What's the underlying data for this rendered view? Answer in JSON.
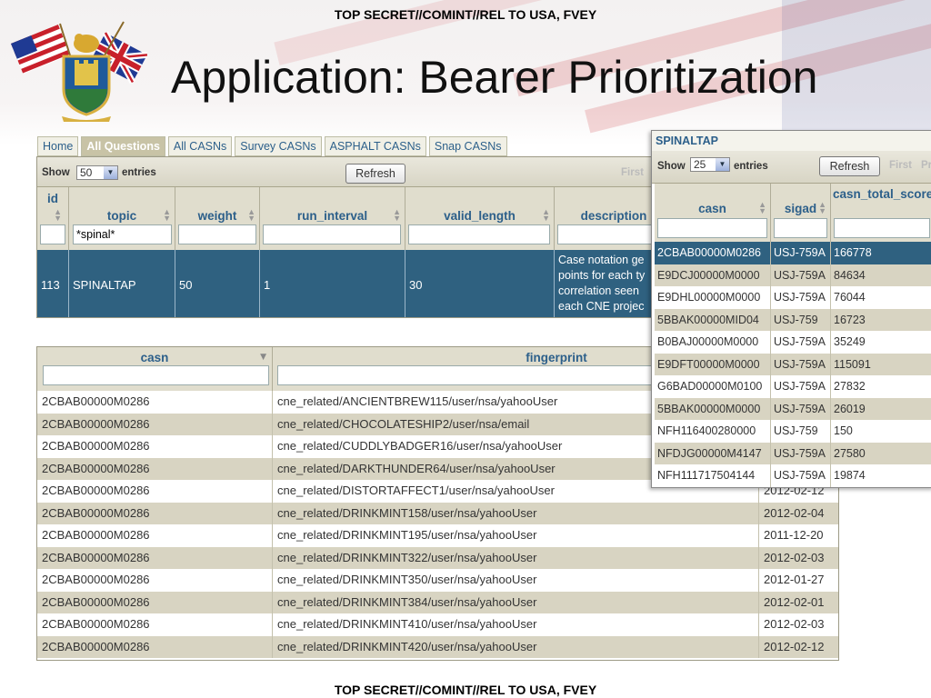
{
  "classification": "TOP SECRET//COMINT//REL TO USA, FVEY",
  "title": "Application: Bearer Prioritization",
  "tabs": [
    "Home",
    "All Questions",
    "All CASNs",
    "Survey CASNs",
    "ASPHALT CASNs",
    "Snap CASNs"
  ],
  "active_tab": "All Questions",
  "questions": {
    "show_label": "Show",
    "entries_label": "entries",
    "page_size": "50",
    "refresh_label": "Refresh",
    "first_label": "First",
    "columns": [
      "id",
      "topic",
      "weight",
      "run_interval",
      "valid_length",
      "description"
    ],
    "topic_filter": "*spinal*",
    "row": {
      "id": "113",
      "topic": "SPINALTAP",
      "weight": "50",
      "run_interval": "1",
      "valid_length": "30",
      "description": [
        "Case notation ge",
        "points for each ty",
        "correlation seen",
        "each CNE projec"
      ]
    }
  },
  "fingerprints": {
    "columns": [
      "casn",
      "fingerprint"
    ],
    "rows": [
      {
        "casn": "2CBAB00000M0286",
        "fp": "cne_related/ANCIENTBREW115/user/nsa/yahooUser",
        "date": ""
      },
      {
        "casn": "2CBAB00000M0286",
        "fp": "cne_related/CHOCOLATESHIP2/user/nsa/email",
        "date": ""
      },
      {
        "casn": "2CBAB00000M0286",
        "fp": "cne_related/CUDDLYBADGER16/user/nsa/yahooUser",
        "date": ""
      },
      {
        "casn": "2CBAB00000M0286",
        "fp": "cne_related/DARKTHUNDER64/user/nsa/yahooUser",
        "date": ""
      },
      {
        "casn": "2CBAB00000M0286",
        "fp": "cne_related/DISTORTAFFECT1/user/nsa/yahooUser",
        "date": "2012-02-12"
      },
      {
        "casn": "2CBAB00000M0286",
        "fp": "cne_related/DRINKMINT158/user/nsa/yahooUser",
        "date": "2012-02-04"
      },
      {
        "casn": "2CBAB00000M0286",
        "fp": "cne_related/DRINKMINT195/user/nsa/yahooUser",
        "date": "2011-12-20"
      },
      {
        "casn": "2CBAB00000M0286",
        "fp": "cne_related/DRINKMINT322/user/nsa/yahooUser",
        "date": "2012-02-03"
      },
      {
        "casn": "2CBAB00000M0286",
        "fp": "cne_related/DRINKMINT350/user/nsa/yahooUser",
        "date": "2012-01-27"
      },
      {
        "casn": "2CBAB00000M0286",
        "fp": "cne_related/DRINKMINT384/user/nsa/yahooUser",
        "date": "2012-02-01"
      },
      {
        "casn": "2CBAB00000M0286",
        "fp": "cne_related/DRINKMINT410/user/nsa/yahooUser",
        "date": "2012-02-03"
      },
      {
        "casn": "2CBAB00000M0286",
        "fp": "cne_related/DRINKMINT420/user/nsa/yahooUser",
        "date": "2012-02-12"
      }
    ]
  },
  "spinaltap": {
    "title": "SPINALTAP",
    "show_label": "Show",
    "entries_label": "entries",
    "page_size": "25",
    "refresh_label": "Refresh",
    "first_label": "First",
    "next_partial": "Pr",
    "columns": [
      "casn",
      "sigad",
      "casn_total_score"
    ],
    "rows": [
      {
        "casn": "2CBAB00000M0286",
        "sigad": "USJ-759A",
        "score": "166778"
      },
      {
        "casn": "E9DCJ00000M0000",
        "sigad": "USJ-759A",
        "score": "84634"
      },
      {
        "casn": "E9DHL00000M0000",
        "sigad": "USJ-759A",
        "score": "76044"
      },
      {
        "casn": "5BBAK00000MID04",
        "sigad": "USJ-759",
        "score": "16723"
      },
      {
        "casn": "B0BAJ00000M0000",
        "sigad": "USJ-759A",
        "score": "35249"
      },
      {
        "casn": "E9DFT00000M0000",
        "sigad": "USJ-759A",
        "score": "115091"
      },
      {
        "casn": "G6BAD00000M0100",
        "sigad": "USJ-759A",
        "score": "27832"
      },
      {
        "casn": "5BBAK00000M0000",
        "sigad": "USJ-759A",
        "score": "26019"
      },
      {
        "casn": "NFH116400280000",
        "sigad": "USJ-759",
        "score": "150"
      },
      {
        "casn": "NFDJG00000M4147",
        "sigad": "USJ-759A",
        "score": "27580"
      },
      {
        "casn": "NFH111717504144",
        "sigad": "USJ-759A",
        "score": "19874"
      }
    ]
  }
}
